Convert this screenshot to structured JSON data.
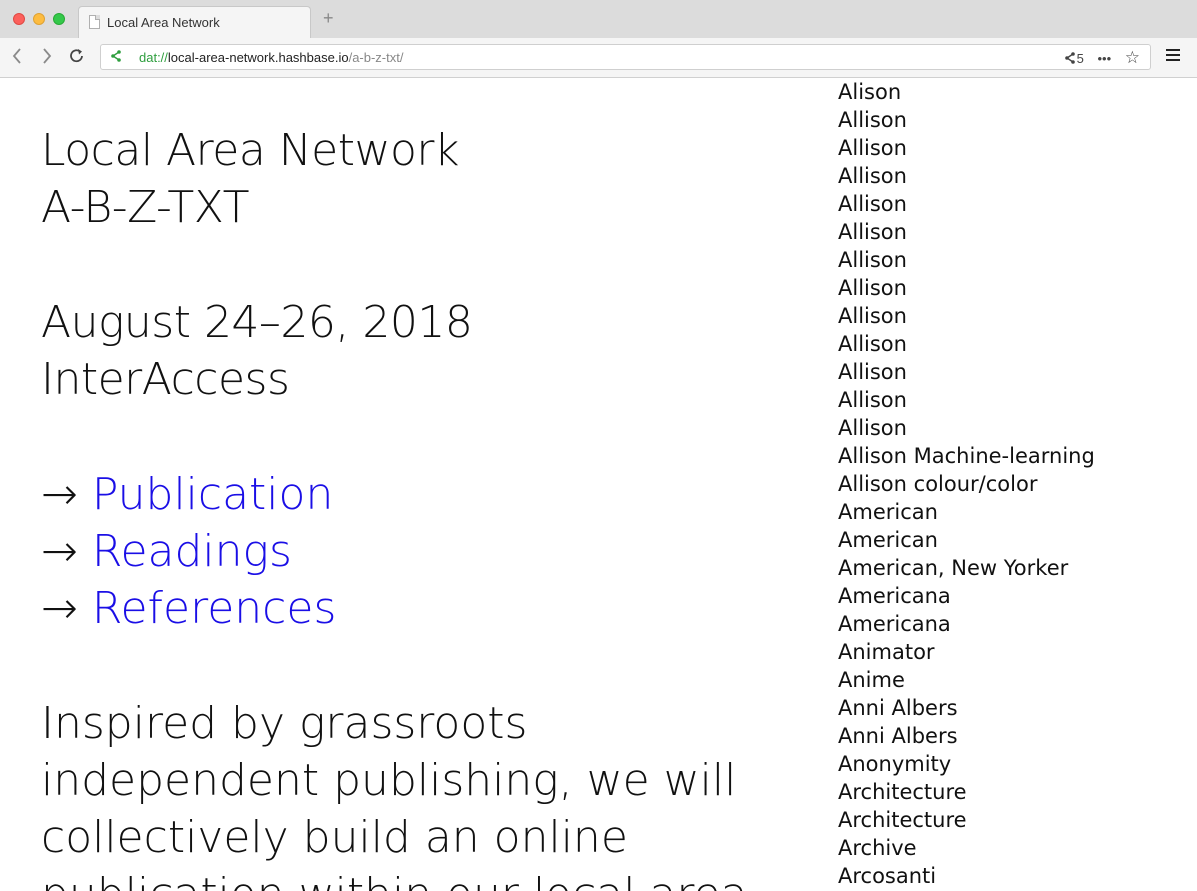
{
  "browser": {
    "tab_title": "Local Area Network",
    "new_tab_glyph": "+",
    "url_scheme": "dat://",
    "url_host": "local-area-network.hashbase.io",
    "url_path": "/a-b-z-txt/",
    "share_count": "5",
    "more_glyph": "•••",
    "star_glyph": "☆"
  },
  "page": {
    "title_line1": "Local Area Network",
    "title_line2": "A-B-Z-TXT",
    "date": "August 24–26, 2018",
    "venue": "InterAccess",
    "arrow": "→",
    "links": [
      "Publication",
      "Readings",
      "References"
    ],
    "blurb": "Inspired by grassroots independent publishing, we will collectively build an online publication within our local area"
  },
  "index_list": [
    "Alison",
    "Allison",
    "Allison",
    "Allison",
    "Allison",
    "Allison",
    "Allison",
    "Allison",
    "Allison",
    "Allison",
    "Allison",
    "Allison",
    "Allison",
    "Allison Machine-learning",
    "Allison colour/color",
    "American",
    "American",
    "American, New Yorker",
    "Americana",
    "Americana",
    "Animator",
    "Anime",
    "Anni Albers",
    "Anni Albers",
    "Anonymity",
    "Architecture",
    "Architecture",
    "Archive",
    "Arcosanti"
  ],
  "colors": {
    "link": "#1a0ee6",
    "secure_green": "#2e9e3e"
  }
}
